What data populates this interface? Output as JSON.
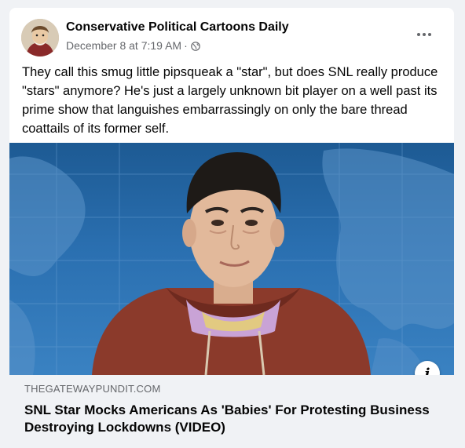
{
  "post": {
    "page_name": "Conservative Political Cartoons Daily",
    "timestamp": "December 8 at 7:19 AM",
    "separator": "·",
    "privacy_icon": "globe-icon",
    "more_icon": "more-options-icon",
    "text": "They call this smug little pipsqueak a \"star\", but does SNL really produce \"stars\" anymore? He's just a largely unknown bit player on a well past its prime show that languishes embarrassingly on only the bare thread  coattails of its former self."
  },
  "link_preview": {
    "info_icon": "info-icon",
    "info_glyph": "i",
    "domain": "THEGATEWAYPUNDIT.COM",
    "title": "SNL Star Mocks Americans As 'Babies' For Protesting Business Destroying Lockdowns (VIDEO)"
  },
  "colors": {
    "background": "#f0f2f5",
    "card": "#ffffff",
    "primary_text": "#050505",
    "secondary_text": "#65676b",
    "map_blue": "#2a6fb0"
  }
}
